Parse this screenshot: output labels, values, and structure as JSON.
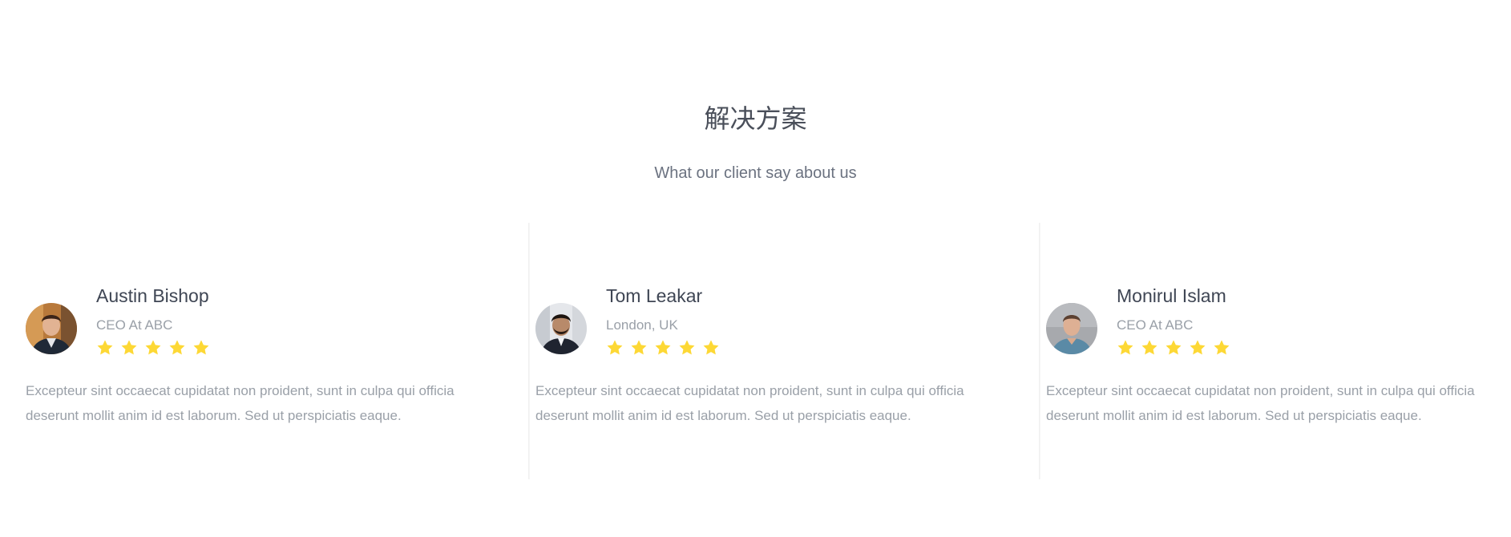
{
  "section": {
    "title": "解决方案",
    "subtitle": "What our client say about us"
  },
  "colors": {
    "star": "#fdd835",
    "heading": "#4a4f5a",
    "muted": "#9aa0a8"
  },
  "testimonials": [
    {
      "name": "Austin Bishop",
      "role": "CEO At ABC",
      "rating": 5,
      "text": "Excepteur sint occaecat cupidatat non proident, sunt in culpa qui officia deserunt mollit anim id est laborum. Sed ut perspiciatis eaque."
    },
    {
      "name": "Tom Leakar",
      "role": "London, UK",
      "rating": 5,
      "text": "Excepteur sint occaecat cupidatat non proident, sunt in culpa qui officia deserunt mollit anim id est laborum. Sed ut perspiciatis eaque."
    },
    {
      "name": "Monirul Islam",
      "role": "CEO At ABC",
      "rating": 5,
      "text": "Excepteur sint occaecat cupidatat non proident, sunt in culpa qui officia deserunt mollit anim id est laborum. Sed ut perspiciatis eaque."
    }
  ]
}
